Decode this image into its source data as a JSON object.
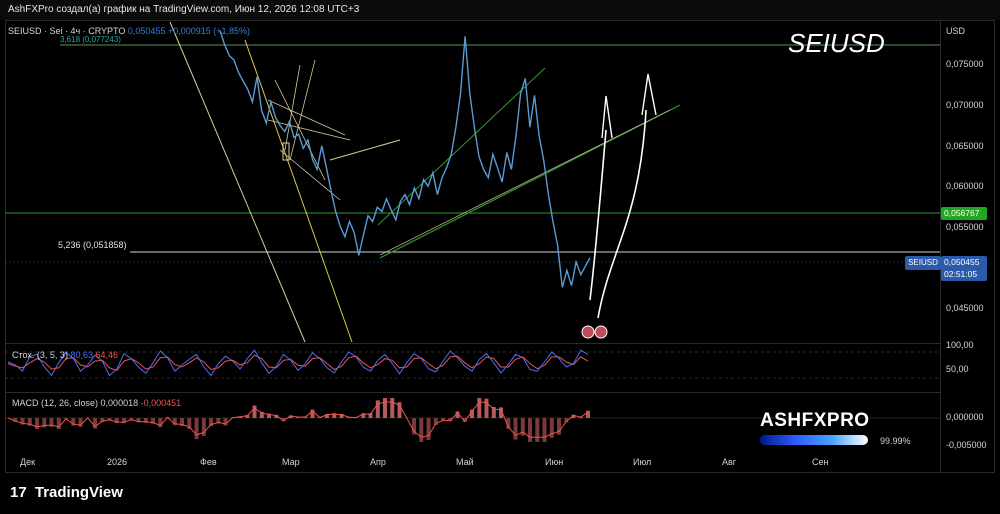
{
  "header": {
    "text": "AshFXPro создал(а) график на TradingView.com, Июн 12, 2026 12:08 UTC+3"
  },
  "symbol": {
    "name": "SEIUSD · Sei · 4ч · CRYPTO",
    "price": "0,050455",
    "change": "+0,000915 (+1,85%)"
  },
  "big_title": "SEIUSD",
  "fib": {
    "level_high": "3,618 (0,077243)",
    "level_low": "5,236 (0,051858)"
  },
  "axis": {
    "currency": "USD",
    "labels": [
      "0,075000",
      "0,070000",
      "0,065000",
      "0,060000",
      "0,055000",
      "0,045000"
    ],
    "green_line_value": "0,056767",
    "price_tag_symbol": "SEIUSD",
    "price_tag_value": "0,050455",
    "countdown": "02:51:05",
    "stoch_labels": [
      "100,00",
      "50,00"
    ],
    "macd_labels": [
      "0,000000",
      "-0,005000"
    ]
  },
  "stoch": {
    "name": "Стох. (3, 5, 3)",
    "k": "80,63",
    "d": "64,46"
  },
  "macd": {
    "name": "MACD (12, 26, close)",
    "hist": "0,000018",
    "signal": "-0,000451"
  },
  "time_labels": [
    "Дек",
    "2026",
    "Фев",
    "Мар",
    "Апр",
    "Май",
    "Июн",
    "Июл",
    "Авг",
    "Сен"
  ],
  "brand": {
    "name": "ASHFXPRO",
    "percent": "99.99%",
    "progress": 0.9999
  },
  "footer": {
    "name": "TradingView"
  },
  "chart_data": {
    "type": "line",
    "y_range": [
      0.0405,
      0.0785
    ],
    "series": [
      {
        "values": [
          0.0775,
          0.0758,
          0.0745,
          0.074,
          0.0725,
          0.0715,
          0.0705,
          0.069,
          0.072,
          0.068,
          0.0665,
          0.069,
          0.0672,
          0.0662,
          0.0655,
          0.0667,
          0.0648,
          0.0652,
          0.0635,
          0.0645,
          0.0622,
          0.061,
          0.0638,
          0.0612,
          0.0585,
          0.056,
          0.0542,
          0.053,
          0.0548,
          0.0535,
          0.0508,
          0.0532,
          0.0555,
          0.0548,
          0.0565,
          0.056,
          0.0575,
          0.0562,
          0.055,
          0.0572,
          0.058,
          0.0568,
          0.0588,
          0.0575,
          0.0598,
          0.059,
          0.0606,
          0.058,
          0.06,
          0.0612,
          0.0628,
          0.066,
          0.07,
          0.0768,
          0.07,
          0.066,
          0.0625,
          0.061,
          0.06,
          0.0628,
          0.0612,
          0.0595,
          0.063,
          0.061,
          0.065,
          0.07,
          0.0718,
          0.066,
          0.0698,
          0.065,
          0.062,
          0.058,
          0.0548,
          0.052,
          0.047,
          0.049,
          0.0472,
          0.05,
          0.0485,
          0.0495,
          0.0505
        ]
      }
    ],
    "stoch_k": [
      62,
      55,
      40,
      75,
      80,
      50,
      30,
      60,
      85,
      70,
      40,
      55,
      78,
      64,
      30,
      45,
      82,
      70,
      50,
      35,
      60,
      88,
      72,
      40,
      55,
      68,
      80,
      50,
      30,
      58,
      76,
      64,
      45,
      70,
      90,
      60,
      35,
      52,
      80,
      66,
      42,
      58,
      84,
      70,
      48,
      36,
      62,
      86,
      74,
      50,
      40,
      66,
      80,
      58,
      34,
      60,
      82,
      70,
      46,
      38,
      64,
      88,
      72,
      52,
      40,
      68,
      82,
      60,
      36,
      56,
      80,
      72,
      44,
      40,
      62,
      86,
      70,
      50,
      58,
      90,
      80
    ],
    "stoch_d": [
      58,
      52,
      48,
      60,
      70,
      62,
      45,
      48,
      70,
      72,
      55,
      50,
      64,
      66,
      48,
      42,
      64,
      70,
      60,
      45,
      50,
      72,
      74,
      56,
      50,
      60,
      72,
      62,
      44,
      48,
      64,
      66,
      55,
      60,
      78,
      70,
      50,
      48,
      66,
      68,
      54,
      52,
      70,
      72,
      58,
      44,
      52,
      72,
      76,
      60,
      48,
      56,
      70,
      66,
      48,
      50,
      70,
      72,
      58,
      46,
      54,
      74,
      76,
      60,
      48,
      58,
      74,
      70,
      50,
      50,
      68,
      74,
      58,
      46,
      54,
      74,
      74,
      62,
      56,
      74,
      64
    ]
  }
}
